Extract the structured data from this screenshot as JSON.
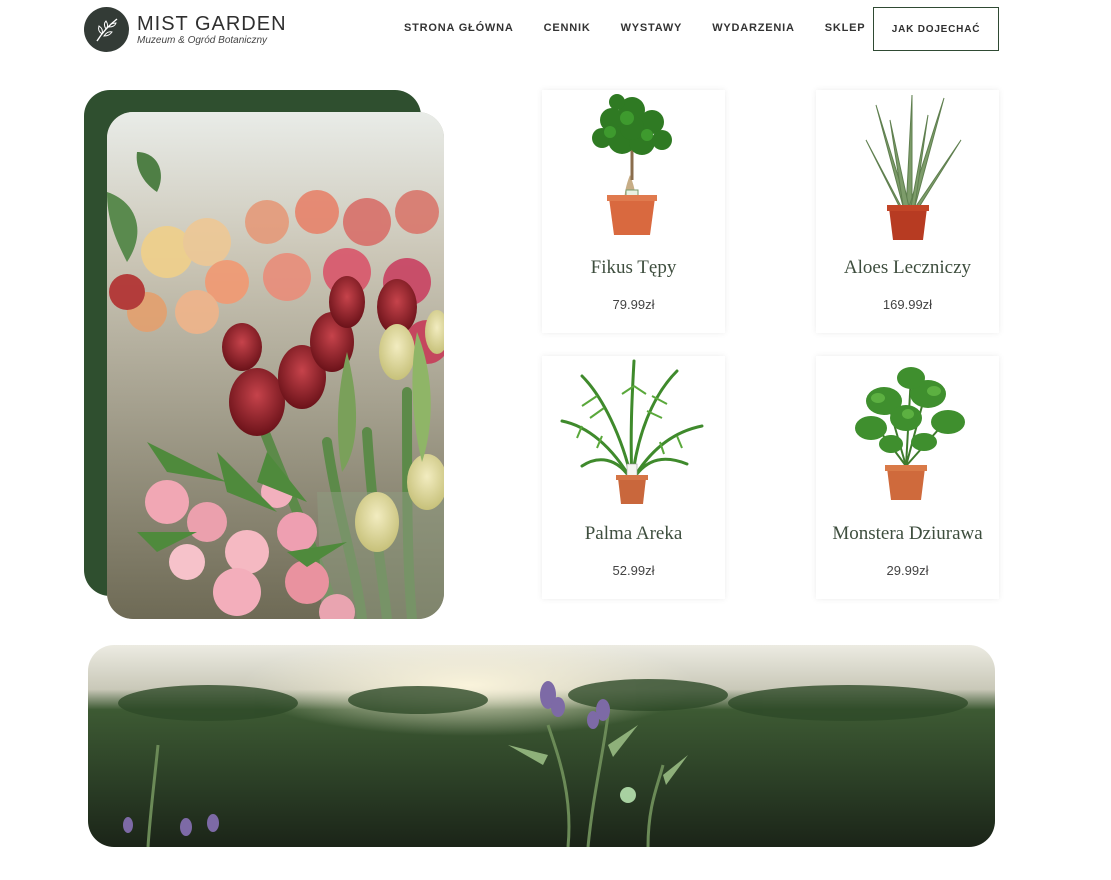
{
  "brand": {
    "title": "MIST GARDEN",
    "subtitle": "Muzeum & Ogród Botaniczny"
  },
  "nav": {
    "items": [
      "STRONA GŁÓWNA",
      "CENNIK",
      "WYSTAWY",
      "WYDARZENIA",
      "SKLEP"
    ],
    "cta": "JAK DOJECHAĆ"
  },
  "products": [
    {
      "name": "Fikus Tępy",
      "price": "79.99zł"
    },
    {
      "name": "Aloes Leczniczy",
      "price": "169.99zł"
    },
    {
      "name": "Palma Areka",
      "price": "52.99zł"
    },
    {
      "name": "Monstera Dziurawa",
      "price": "29.99zł"
    }
  ],
  "colors": {
    "accent": "#2f4f2f",
    "text": "#333333"
  }
}
